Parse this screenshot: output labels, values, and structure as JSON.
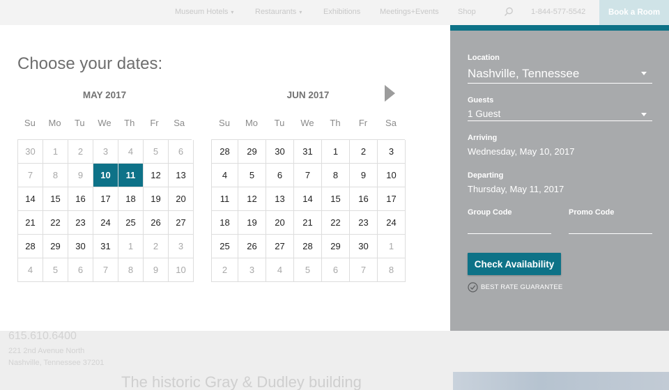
{
  "nav": {
    "items": [
      {
        "label": "Museum Hotels",
        "caret": true
      },
      {
        "label": "Restaurants",
        "caret": true
      },
      {
        "label": "Exhibitions",
        "caret": false
      },
      {
        "label": "Meetings+Events",
        "caret": false
      },
      {
        "label": "Shop",
        "caret": false
      }
    ],
    "phone": "1-844-577-5542",
    "book_label": "Book a Room"
  },
  "background": {
    "phone": "615.610.6400",
    "address_line1": "221 2nd Avenue North",
    "address_line2": "Nashville, Tennessee 37201",
    "headline": "The historic Gray & Dudley building"
  },
  "calendar": {
    "title": "Choose your dates:",
    "weekdays": [
      "Su",
      "Mo",
      "Tu",
      "We",
      "Th",
      "Fr",
      "Sa"
    ],
    "months": [
      {
        "name": "MAY 2017",
        "days": [
          {
            "d": "30",
            "muted": true
          },
          {
            "d": "1",
            "muted": true
          },
          {
            "d": "2",
            "muted": true
          },
          {
            "d": "3",
            "muted": true
          },
          {
            "d": "4",
            "muted": true
          },
          {
            "d": "5",
            "muted": true
          },
          {
            "d": "6",
            "muted": true
          },
          {
            "d": "7",
            "muted": true
          },
          {
            "d": "8",
            "muted": true
          },
          {
            "d": "9",
            "muted": true
          },
          {
            "d": "10",
            "selected": true
          },
          {
            "d": "11",
            "selected": true
          },
          {
            "d": "12"
          },
          {
            "d": "13"
          },
          {
            "d": "14"
          },
          {
            "d": "15"
          },
          {
            "d": "16"
          },
          {
            "d": "17"
          },
          {
            "d": "18"
          },
          {
            "d": "19"
          },
          {
            "d": "20"
          },
          {
            "d": "21"
          },
          {
            "d": "22"
          },
          {
            "d": "23"
          },
          {
            "d": "24"
          },
          {
            "d": "25"
          },
          {
            "d": "26"
          },
          {
            "d": "27"
          },
          {
            "d": "28"
          },
          {
            "d": "29"
          },
          {
            "d": "30"
          },
          {
            "d": "31"
          },
          {
            "d": "1",
            "muted": true
          },
          {
            "d": "2",
            "muted": true
          },
          {
            "d": "3",
            "muted": true
          },
          {
            "d": "4",
            "muted": true
          },
          {
            "d": "5",
            "muted": true
          },
          {
            "d": "6",
            "muted": true
          },
          {
            "d": "7",
            "muted": true
          },
          {
            "d": "8",
            "muted": true
          },
          {
            "d": "9",
            "muted": true
          },
          {
            "d": "10",
            "muted": true
          }
        ]
      },
      {
        "name": "JUN 2017",
        "days": [
          {
            "d": "28"
          },
          {
            "d": "29"
          },
          {
            "d": "30"
          },
          {
            "d": "31"
          },
          {
            "d": "1"
          },
          {
            "d": "2"
          },
          {
            "d": "3"
          },
          {
            "d": "4"
          },
          {
            "d": "5"
          },
          {
            "d": "6"
          },
          {
            "d": "7"
          },
          {
            "d": "8"
          },
          {
            "d": "9"
          },
          {
            "d": "10"
          },
          {
            "d": "11"
          },
          {
            "d": "12"
          },
          {
            "d": "13"
          },
          {
            "d": "14"
          },
          {
            "d": "15"
          },
          {
            "d": "16"
          },
          {
            "d": "17"
          },
          {
            "d": "18"
          },
          {
            "d": "19"
          },
          {
            "d": "20"
          },
          {
            "d": "21"
          },
          {
            "d": "22"
          },
          {
            "d": "23"
          },
          {
            "d": "24"
          },
          {
            "d": "25"
          },
          {
            "d": "26"
          },
          {
            "d": "27"
          },
          {
            "d": "28"
          },
          {
            "d": "29"
          },
          {
            "d": "30"
          },
          {
            "d": "1",
            "muted": true
          },
          {
            "d": "2",
            "muted": true
          },
          {
            "d": "3",
            "muted": true
          },
          {
            "d": "4",
            "muted": true
          },
          {
            "d": "5",
            "muted": true
          },
          {
            "d": "6",
            "muted": true
          },
          {
            "d": "7",
            "muted": true
          },
          {
            "d": "8",
            "muted": true
          }
        ]
      }
    ],
    "next_icon": "chevron-right-icon"
  },
  "booking": {
    "location_label": "Location",
    "location_value": "Nashville, Tennessee",
    "guests_label": "Guests",
    "guests_value": "1 Guest",
    "arriving_label": "Arriving",
    "arriving_value": "Wednesday, May 10, 2017",
    "departing_label": "Departing",
    "departing_value": "Thursday, May 11, 2017",
    "group_code_label": "Group Code",
    "group_code_value": "",
    "promo_code_label": "Promo Code",
    "promo_code_value": "",
    "check_label": "Check Availability",
    "guarantee_label": "BEST RATE GUARANTEE"
  },
  "colors": {
    "accent": "#0e7288",
    "side_panel": "#a8aaac",
    "book_button": "#cfe3e7"
  }
}
